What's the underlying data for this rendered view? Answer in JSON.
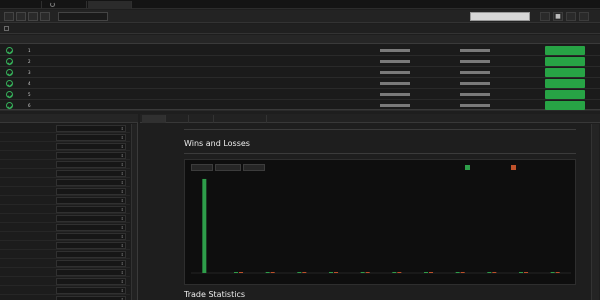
{
  "window_tabs": [
    {
      "label": "",
      "active": false
    },
    {
      "label": "",
      "active": false
    },
    {
      "label": "",
      "active": true
    }
  ],
  "toolbar": {
    "buttons": [
      "",
      "",
      "",
      ""
    ],
    "field_value": "",
    "right_field_value": ""
  },
  "options": [
    "",
    "",
    "",
    "",
    ""
  ],
  "grid": {
    "headers": [
      "",
      "",
      "",
      "",
      "",
      "",
      "",
      "",
      "",
      "",
      "",
      "",
      "",
      "",
      "",
      "",
      ""
    ],
    "rows": [
      {
        "num": "1",
        "cells": [
          "",
          "",
          "",
          "",
          "",
          "",
          "",
          "",
          "",
          "",
          "",
          ""
        ],
        "action": ""
      },
      {
        "num": "2",
        "cells": [
          "",
          "",
          "",
          "",
          "",
          "",
          "",
          "",
          "",
          "",
          "",
          ""
        ],
        "action": ""
      },
      {
        "num": "3",
        "cells": [
          "",
          "",
          "",
          "",
          "",
          "",
          "",
          "",
          "",
          "",
          "",
          ""
        ],
        "action": ""
      },
      {
        "num": "4",
        "cells": [
          "",
          "",
          "",
          "",
          "",
          "",
          "",
          "",
          "",
          "",
          "",
          ""
        ],
        "action": ""
      },
      {
        "num": "5",
        "cells": [
          "",
          "",
          "",
          "",
          "",
          "",
          "",
          "",
          "",
          "",
          "",
          ""
        ],
        "action": ""
      },
      {
        "num": "6",
        "cells": [
          "",
          "",
          "",
          "",
          "",
          "",
          "",
          "",
          "",
          "",
          "",
          ""
        ],
        "action": ""
      }
    ],
    "status_color": "#36b05a",
    "action_color": "#27a345"
  },
  "params": {
    "title": "",
    "rows": [
      {
        "label": "",
        "value": ""
      },
      {
        "label": "",
        "value": ""
      },
      {
        "label": "",
        "value": ""
      },
      {
        "label": "",
        "value": ""
      },
      {
        "label": "",
        "value": ""
      },
      {
        "label": "",
        "value": ""
      },
      {
        "label": "",
        "value": ""
      },
      {
        "label": "",
        "value": ""
      },
      {
        "label": "",
        "value": ""
      },
      {
        "label": "",
        "value": ""
      },
      {
        "label": "",
        "value": ""
      },
      {
        "label": "",
        "value": ""
      },
      {
        "label": "",
        "value": ""
      },
      {
        "label": "",
        "value": ""
      },
      {
        "label": "",
        "value": ""
      },
      {
        "label": "",
        "value": ""
      },
      {
        "label": "",
        "value": ""
      },
      {
        "label": "",
        "value": ""
      },
      {
        "label": "",
        "value": ""
      },
      {
        "label": "",
        "value": ""
      }
    ]
  },
  "report_tabs": [
    {
      "label": "",
      "active": true
    },
    {
      "label": "",
      "active": false
    },
    {
      "label": "",
      "active": false
    },
    {
      "label": "",
      "active": false
    }
  ],
  "report": {
    "wins_losses_title": "Wins and Losses",
    "trade_stats_title": "Trade Statistics",
    "chart_tabs": [
      "",
      "",
      ""
    ]
  },
  "chart_data": {
    "type": "bar",
    "title": "Wins and Losses",
    "categories": [
      "",
      "",
      "",
      "",
      "",
      "",
      "",
      "",
      "",
      "",
      "",
      ""
    ],
    "series": [
      {
        "name": "",
        "color": "#2e9e4a",
        "values": [
          95,
          1,
          1,
          1,
          1,
          1,
          1,
          1,
          1,
          1,
          1,
          1
        ]
      },
      {
        "name": "",
        "color": "#c0522b",
        "values": [
          0,
          1,
          1,
          1,
          1,
          1,
          1,
          1,
          1,
          1,
          1,
          1
        ]
      }
    ],
    "ylim": [
      0,
      100
    ],
    "grid": false,
    "legend": "top-right"
  }
}
